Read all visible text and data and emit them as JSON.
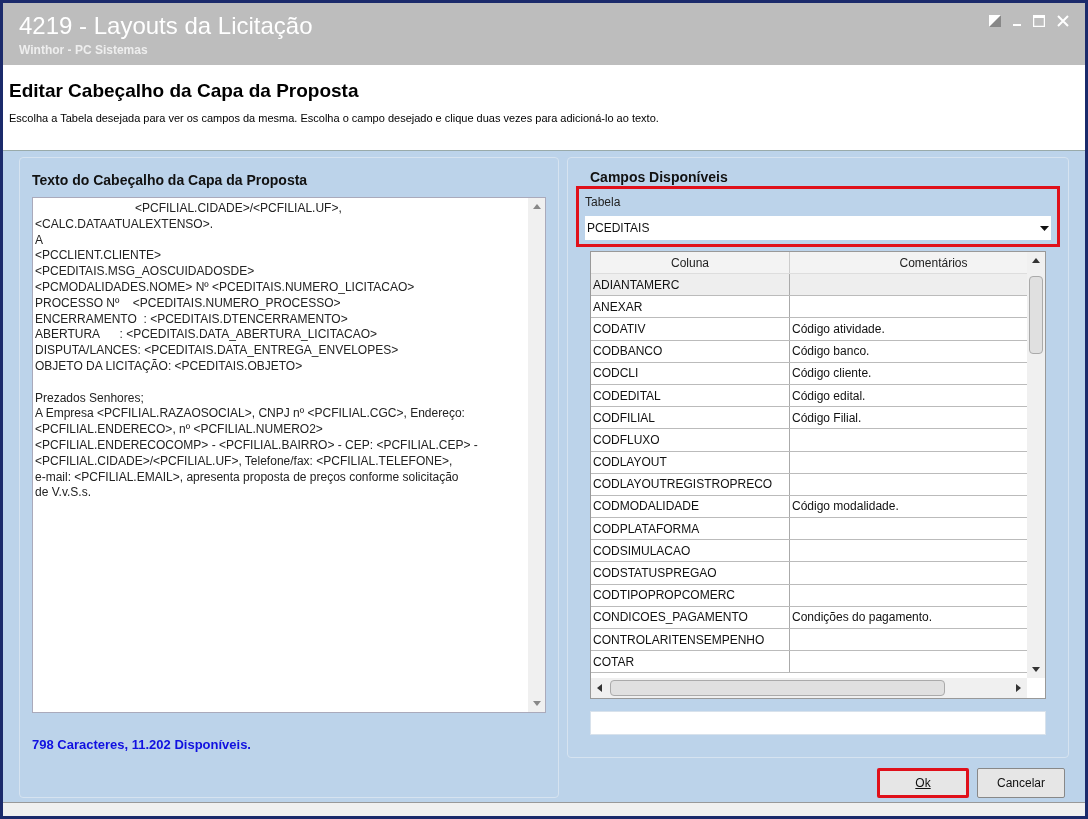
{
  "window": {
    "title": "4219 - Layouts da Licitação",
    "subtitle": "Winthor - PC Sistemas"
  },
  "header": {
    "title": "Editar Cabeçalho da Capa da Proposta",
    "description": "Escolha a Tabela desejada para ver os campos da mesma. Escolha o campo desejado e clique duas vezes para adicioná-lo ao texto."
  },
  "editor": {
    "title": "Texto do Cabeçalho da Capa da Proposta",
    "paragraphs": [
      [
        "                              <PCFILIAL.CIDADE>/<PCFILIAL.UF>,",
        "<CALC.DATAATUALEXTENSO>.",
        "A",
        "<PCCLIENT.CLIENTE>",
        "<PCEDITAIS.MSG_AOSCUIDADOSDE>",
        "<PCMODALIDADES.NOME> Nº <PCEDITAIS.NUMERO_LICITACAO>",
        "PROCESSO Nº    <PCEDITAIS.NUMERO_PROCESSO>",
        "ENCERRAMENTO  : <PCEDITAIS.DTENCERRAMENTO>",
        "ABERTURA      : <PCEDITAIS.DATA_ABERTURA_LICITACAO>",
        "DISPUTA/LANCES: <PCEDITAIS.DATA_ENTREGA_ENVELOPES>",
        "OBJETO DA LICITAÇÃO: <PCEDITAIS.OBJETO>"
      ],
      [
        "Prezados Senhores;",
        "A Empresa <PCFILIAL.RAZAOSOCIAL>, CNPJ nº <PCFILIAL.CGC>, Endereço:",
        "<PCFILIAL.ENDERECO>, nº <PCFILIAL.NUMERO2>",
        "<PCFILIAL.ENDERECOCOMP> - <PCFILIAL.BAIRRO> - CEP: <PCFILIAL.CEP> -",
        "<PCFILIAL.CIDADE>/<PCFILIAL.UF>, Telefone/fax: <PCFILIAL.TELEFONE>,",
        "e-mail: <PCFILIAL.EMAIL>, apresenta proposta de preços conforme solicitação",
        "de V.v.S.s."
      ]
    ],
    "counter": "798 Caracteres, 11.202 Disponíveis."
  },
  "fields": {
    "title": "Campos Disponíveis",
    "table_label": "Tabela",
    "table_value": "PCEDITAIS",
    "highlighted": true,
    "columns": [
      "Coluna",
      "Comentários"
    ],
    "rows": [
      {
        "coluna": "ADIANTAMERC",
        "comentario": "",
        "selected": true
      },
      {
        "coluna": "ANEXAR",
        "comentario": "",
        "selected": false
      },
      {
        "coluna": "CODATIV",
        "comentario": "Código atividade.",
        "selected": false
      },
      {
        "coluna": "CODBANCO",
        "comentario": "Código banco.",
        "selected": false
      },
      {
        "coluna": "CODCLI",
        "comentario": "Código cliente.",
        "selected": false
      },
      {
        "coluna": "CODEDITAL",
        "comentario": "Código edital.",
        "selected": false
      },
      {
        "coluna": "CODFILIAL",
        "comentario": "Código Filial.",
        "selected": false
      },
      {
        "coluna": "CODFLUXO",
        "comentario": "",
        "selected": false
      },
      {
        "coluna": "CODLAYOUT",
        "comentario": "",
        "selected": false
      },
      {
        "coluna": "CODLAYOUTREGISTROPRECO",
        "comentario": "",
        "selected": false
      },
      {
        "coluna": "CODMODALIDADE",
        "comentario": "Código modalidade.",
        "selected": false
      },
      {
        "coluna": "CODPLATAFORMA",
        "comentario": "",
        "selected": false
      },
      {
        "coluna": "CODSIMULACAO",
        "comentario": "",
        "selected": false
      },
      {
        "coluna": "CODSTATUSPREGAO",
        "comentario": "",
        "selected": false
      },
      {
        "coluna": "CODTIPOPROPCOMERC",
        "comentario": "",
        "selected": false
      },
      {
        "coluna": "CONDICOES_PAGAMENTO",
        "comentario": "Condições do pagamento.",
        "selected": false
      },
      {
        "coluna": "CONTROLARITENSEMPENHO",
        "comentario": "",
        "selected": false
      },
      {
        "coluna": "COTAR",
        "comentario": "",
        "selected": false
      }
    ]
  },
  "buttons": [
    {
      "kind": "ok",
      "label": "Ok",
      "highlighted": true
    },
    {
      "kind": "cancel",
      "label": "Cancelar",
      "highlighted": false
    }
  ]
}
